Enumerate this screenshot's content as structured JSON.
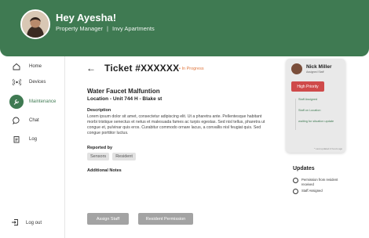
{
  "header": {
    "greeting": "Hey Ayesha!",
    "role": "Property Manager",
    "separator": "|",
    "company": "Invy Apartments"
  },
  "sidebar": {
    "items": [
      {
        "label": "Home",
        "icon": "home-icon"
      },
      {
        "label": "Devices",
        "icon": "broadcast-icon"
      },
      {
        "label": "Maintenance",
        "icon": "wrench-icon",
        "active": true
      },
      {
        "label": "Chat",
        "icon": "chat-bubble-icon"
      },
      {
        "label": "Log",
        "icon": "clipboard-icon"
      }
    ],
    "logout": "Log out"
  },
  "ticket": {
    "back": "←",
    "number": "Ticket #XXXXXX",
    "status": "• In Progress",
    "title": "Water Faucet Malfuntion",
    "location": "Location - Unit 744 H - Blake st",
    "description_label": "Description",
    "description": "Lorem ipsum dolor sit amet, consectetur adipiscing elit. Ut a pharetra ante. Pellentesque habitant morbi tristique senectus et netus et malesuada fames ac turpis egestas. Sed nisl tellus, pharetra ut congue et, pulvinar quis eros. Curabitur commodo ornare lacus, a convallis nisl feugiat quis. Sed congue porttitor luctus.",
    "reported_label": "Reported by",
    "reported_tags": [
      "Sensors",
      "Resident"
    ],
    "notes_label": "Additional Notes",
    "buttons": {
      "assign": "Assign Staff",
      "permission": "Resident Permission"
    }
  },
  "staff": {
    "name": "Nick Miller",
    "role": "Assigned Staff",
    "priority": "High Priority",
    "tracking": [
      "Staff Assigned",
      "Staff on Location",
      "waiting for situation update"
    ],
    "updated": "* Last updated 2 hours ago"
  },
  "updates": {
    "title": "Updates",
    "items": [
      "Permission from resident received",
      "Staff Assigned"
    ]
  },
  "colors": {
    "brand": "#3f7a52",
    "status": "#e07840",
    "priority": "#cf4a4a",
    "button": "#a3a3a3"
  }
}
